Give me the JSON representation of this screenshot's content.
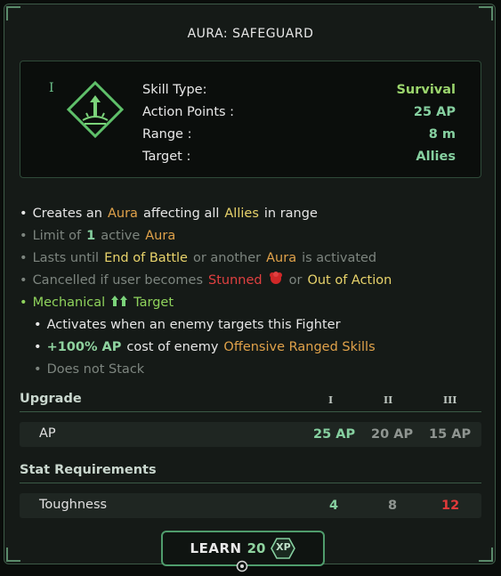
{
  "window": {
    "title": "AURA: SAFEGUARD"
  },
  "skill": {
    "tier": "I",
    "icon": "aura-tower-icon",
    "fields": [
      {
        "label": "Skill Type:",
        "value": "Survival"
      },
      {
        "label": "Action Points :",
        "value": "25 AP"
      },
      {
        "label": "Range :",
        "value": "8 m"
      },
      {
        "label": "Target :",
        "value": "Allies"
      }
    ]
  },
  "description": {
    "l1": {
      "bullet": "•",
      "a": "Creates an",
      "b": "Aura",
      "c": "affecting all",
      "d": "Allies",
      "e": "in range"
    },
    "l2": {
      "bullet": "•",
      "a": "Limit of",
      "b": "1",
      "c": "active",
      "d": "Aura"
    },
    "l3": {
      "bullet": "•",
      "a": "Lasts until",
      "b": "End of Battle",
      "c": "or another",
      "d": "Aura",
      "e": "is activated"
    },
    "l4": {
      "bullet": "•",
      "a": "Cancelled if user becomes",
      "b": "Stunned",
      "c": "or",
      "d": "Out of Action"
    },
    "l5": {
      "bullet": "•",
      "a": "Mechanical",
      "b": "Target"
    },
    "l6": {
      "bullet": "•",
      "a": "Activates when an enemy targets this Fighter"
    },
    "l7": {
      "bullet": "•",
      "a": "+100% AP",
      "b": "cost of enemy",
      "c": "Offensive Ranged Skills"
    },
    "l8": {
      "bullet": "•",
      "a": "Does not Stack"
    }
  },
  "upgrade": {
    "header": "Upgrade",
    "tiers": [
      "I",
      "II",
      "III"
    ],
    "row_label": "AP",
    "values": [
      "25 AP",
      "20 AP",
      "15 AP"
    ]
  },
  "requirements": {
    "header": "Stat Requirements",
    "row_label": "Toughness",
    "values": [
      "4",
      "8",
      "12"
    ]
  },
  "learn": {
    "label": "LEARN",
    "cost": "20",
    "unit": "XP"
  },
  "colors": {
    "accent_green": "#8fd35c",
    "teal_green": "#86d0a0",
    "orange": "#e0a24a",
    "yellow": "#e8d36b",
    "red": "#e04040"
  }
}
